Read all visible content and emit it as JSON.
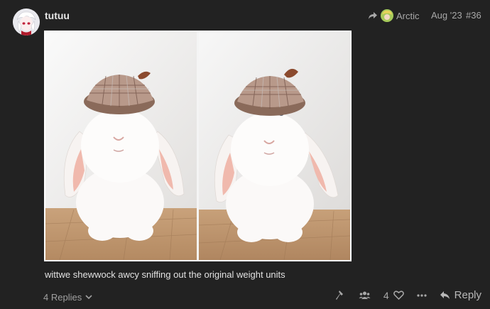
{
  "post": {
    "username": "tutuu",
    "reply_to_user": "Arctic",
    "date": "Aug '23",
    "post_number": "#36",
    "caption": "wittwe shewwock awcy sniffing out the original weight units",
    "replies_label": "4 Replies",
    "like_count": "4",
    "reply_label": "Reply"
  },
  "icons": {
    "reply_arrow": "share-arrow-icon",
    "chevron": "chevron-down-icon",
    "admin": "hammer-icon",
    "users": "users-icon",
    "like": "heart-icon",
    "more": "ellipsis-icon",
    "reply": "reply-icon"
  },
  "colors": {
    "background": "#222222",
    "text": "#dddddd",
    "muted": "#a8a8a8"
  }
}
